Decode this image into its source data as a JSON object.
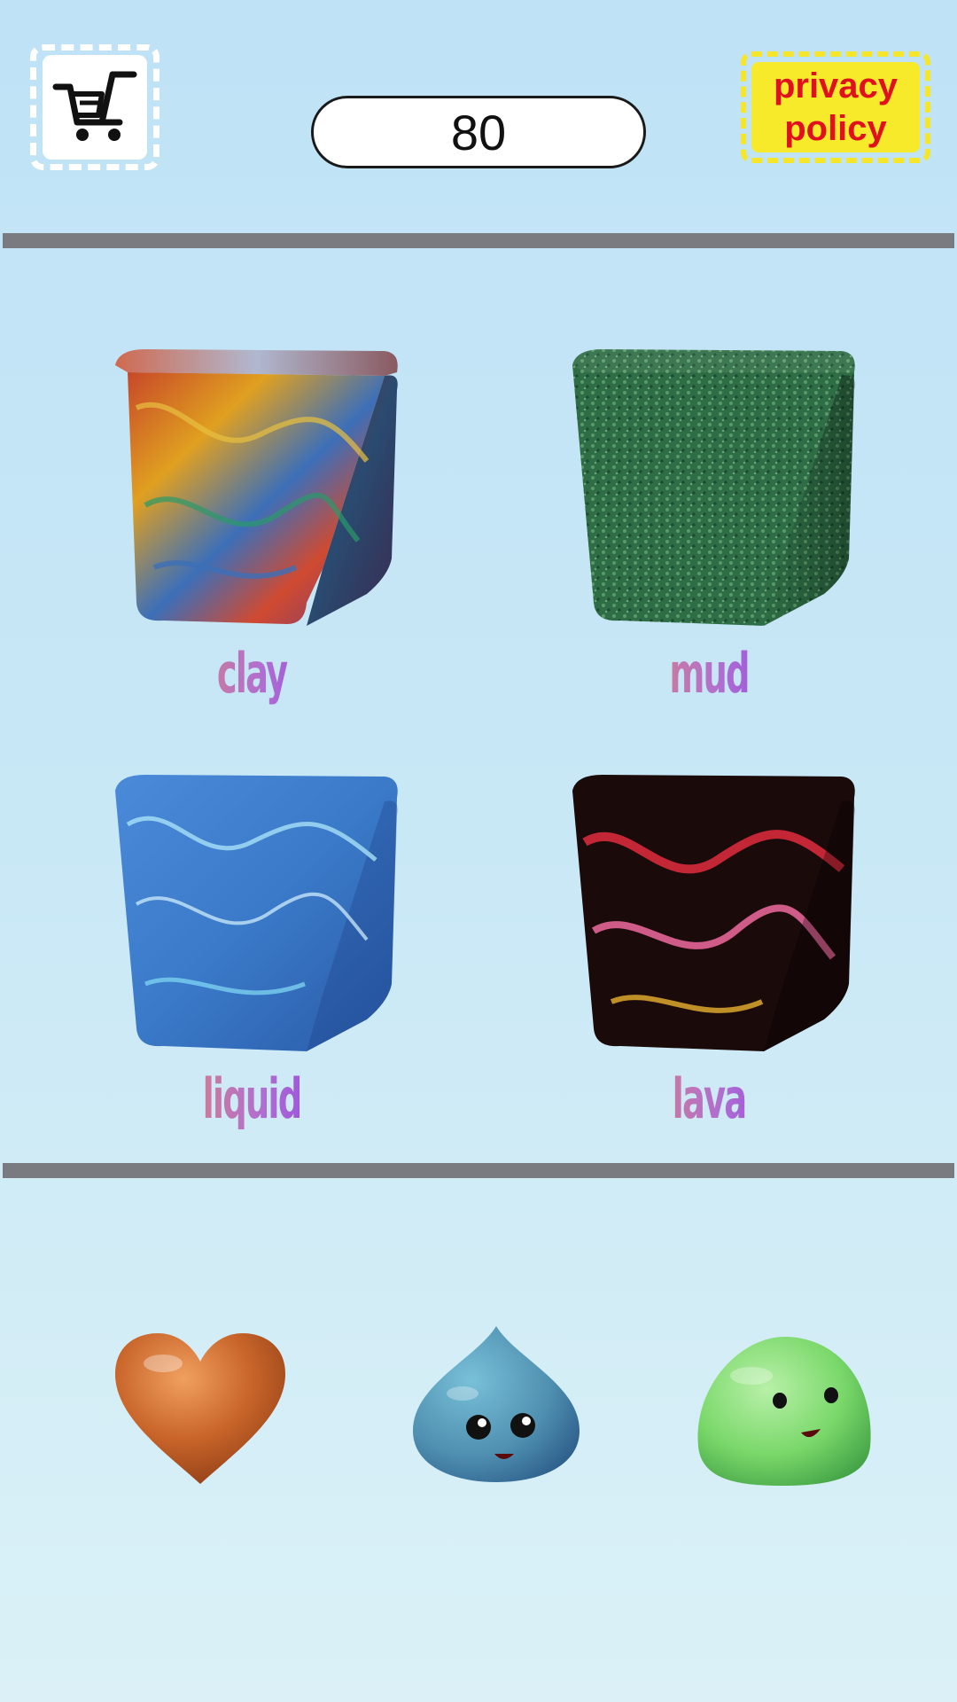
{
  "header": {
    "cart_icon": "shopping-cart-icon",
    "score": "80",
    "privacy_line1": "privacy",
    "privacy_line2": "policy"
  },
  "materials": [
    {
      "label": "clay",
      "texture": "multicolor-swirl",
      "colors": [
        "#c43b2a",
        "#e0a020",
        "#3c6fb8",
        "#2a9a6a"
      ]
    },
    {
      "label": "mud",
      "texture": "green-speckled",
      "colors": [
        "#2e6d45",
        "#4f8f5e",
        "#1d4a30"
      ]
    },
    {
      "label": "liquid",
      "texture": "blue-marble",
      "colors": [
        "#3a7ac8",
        "#6fb2e8",
        "#2a5aa8"
      ]
    },
    {
      "label": "lava",
      "texture": "black-red-swirl",
      "colors": [
        "#1a0a0a",
        "#d62a3a",
        "#f06aa0"
      ]
    }
  ],
  "shapes": [
    {
      "name": "heart",
      "color": "#c9652a"
    },
    {
      "name": "water-drop-character",
      "color": "#4f8fb0"
    },
    {
      "name": "green-slime-character",
      "color": "#7ad86a"
    }
  ]
}
